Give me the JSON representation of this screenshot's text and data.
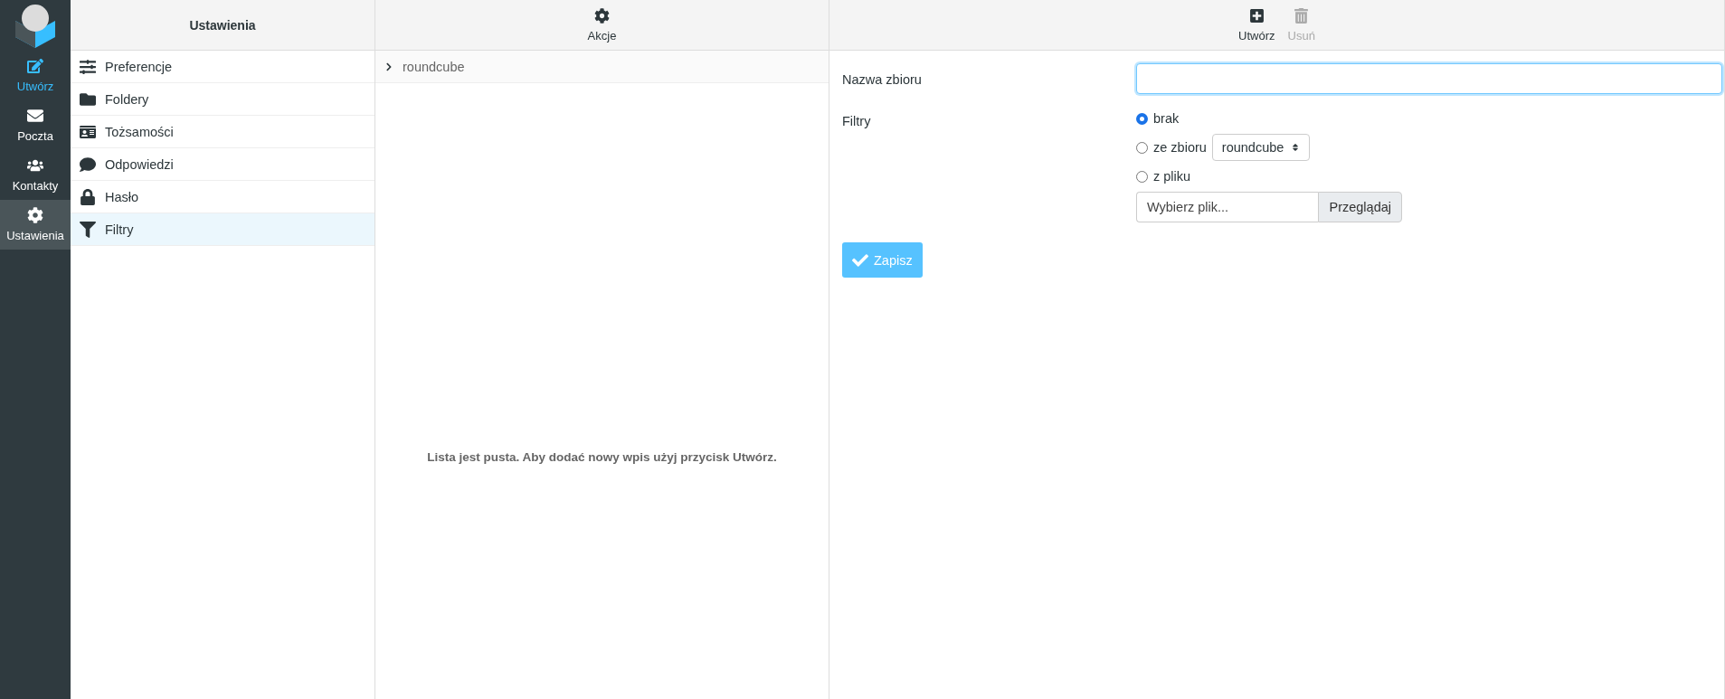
{
  "nav": [
    {
      "label": "Utwórz",
      "kind": "compose",
      "selected": false
    },
    {
      "label": "Poczta",
      "kind": "link",
      "selected": false
    },
    {
      "label": "Kontakty",
      "kind": "link",
      "selected": false
    },
    {
      "label": "Ustawienia",
      "kind": "link",
      "selected": true
    }
  ],
  "settings": {
    "title": "Ustawienia",
    "items": [
      {
        "label": "Preferencje",
        "selected": false
      },
      {
        "label": "Foldery",
        "selected": false
      },
      {
        "label": "Tożsamości",
        "selected": false
      },
      {
        "label": "Odpowiedzi",
        "selected": false
      },
      {
        "label": "Hasło",
        "selected": false
      },
      {
        "label": "Filtry",
        "selected": true
      }
    ]
  },
  "list": {
    "toolbar": [
      {
        "label": "Akcje",
        "disabled": false
      }
    ],
    "items": [
      {
        "label": "roundcube",
        "expanded": false
      }
    ],
    "empty_message": "Lista jest pusta. Aby dodać nowy wpis użyj przycisk Utwórz."
  },
  "form": {
    "toolbar": [
      {
        "label": "Utwórz",
        "disabled": false
      },
      {
        "label": "Usuń",
        "disabled": true
      }
    ],
    "name_label": "Nazwa zbioru",
    "filters_label": "Filtry",
    "options": [
      {
        "label": "brak",
        "kind": "plain",
        "selected": true
      },
      {
        "label": "ze zbioru",
        "kind": "select",
        "value": "roundcube",
        "selected": false
      },
      {
        "label": "z pliku",
        "kind": "plain",
        "selected": false
      }
    ],
    "file": {
      "placeholder": "Wybierz plik...",
      "button": "Przeglądaj"
    },
    "save": "Zapisz"
  }
}
